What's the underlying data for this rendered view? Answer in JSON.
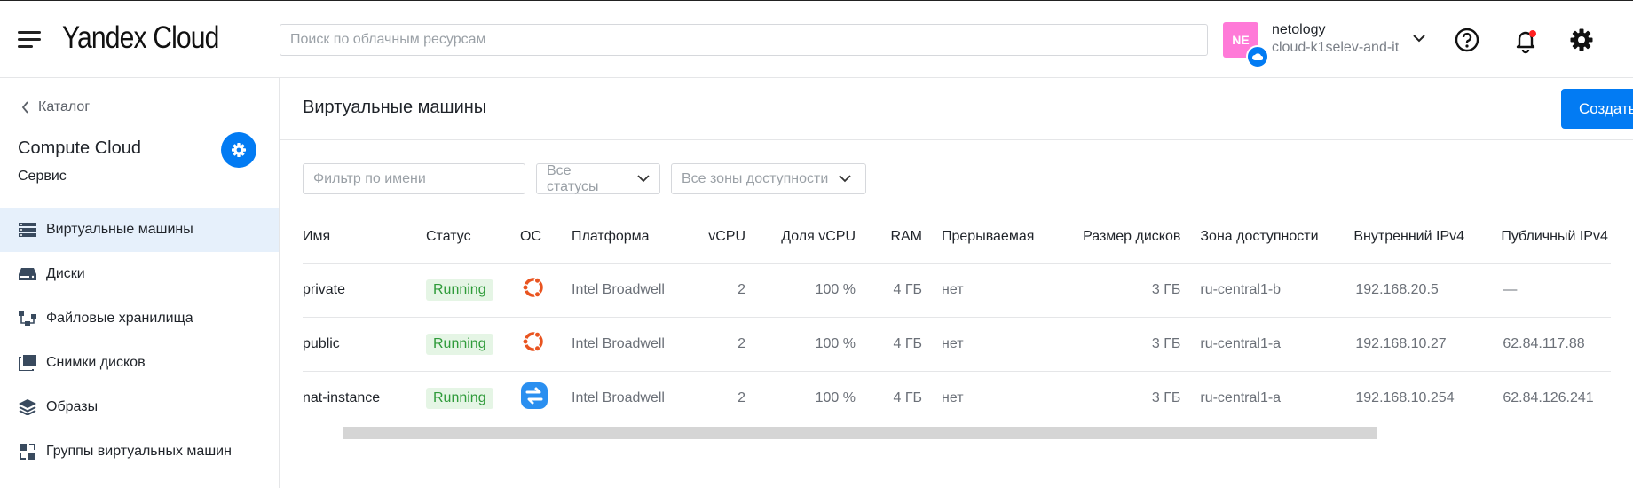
{
  "header": {
    "logo": "Yandex Cloud",
    "search_placeholder": "Поиск по облачным ресурсам",
    "avatar_initials": "NE",
    "account_name": "netology",
    "cloud_name": "cloud-k1selev-and-it"
  },
  "sidebar": {
    "back_label": "Каталог",
    "service_title": "Compute Cloud",
    "service_subtitle": "Сервис",
    "items": [
      {
        "label": "Виртуальные машины",
        "icon": "vm-icon",
        "active": true
      },
      {
        "label": "Диски",
        "icon": "disk-icon",
        "active": false
      },
      {
        "label": "Файловые хранилища",
        "icon": "filestore-icon",
        "active": false
      },
      {
        "label": "Снимки дисков",
        "icon": "snapshot-icon",
        "active": false
      },
      {
        "label": "Образы",
        "icon": "images-icon",
        "active": false
      },
      {
        "label": "Группы виртуальных машин",
        "icon": "instance-group-icon",
        "active": false
      }
    ]
  },
  "main": {
    "title": "Виртуальные машины",
    "create_label": "Создать",
    "filter_placeholder": "Фильтр по имени",
    "status_select": "Все статусы",
    "zone_select": "Все зоны доступности",
    "columns": {
      "name": "Имя",
      "status": "Статус",
      "os": "ОС",
      "platform": "Платформа",
      "vcpu": "vCPU",
      "vcpu_share": "Доля vCPU",
      "ram": "RAM",
      "preemptible": "Прерываемая",
      "disk_size": "Размер дисков",
      "zone": "Зона доступности",
      "internal_ip": "Внутренний IPv4",
      "public_ip": "Публичный IPv4"
    },
    "rows": [
      {
        "name": "private",
        "status": "Running",
        "os_icon": "ubuntu-icon",
        "platform": "Intel Broadwell",
        "vcpu": "2",
        "vcpu_share": "100 %",
        "ram": "4 ГБ",
        "preemptible": "нет",
        "disk_size": "3 ГБ",
        "zone": "ru-central1-b",
        "internal_ip": "192.168.20.5",
        "public_ip": "—"
      },
      {
        "name": "public",
        "status": "Running",
        "os_icon": "ubuntu-icon",
        "platform": "Intel Broadwell",
        "vcpu": "2",
        "vcpu_share": "100 %",
        "ram": "4 ГБ",
        "preemptible": "нет",
        "disk_size": "3 ГБ",
        "zone": "ru-central1-a",
        "internal_ip": "192.168.10.27",
        "public_ip": "62.84.117.88"
      },
      {
        "name": "nat-instance",
        "status": "Running",
        "os_icon": "nat-instance-icon",
        "platform": "Intel Broadwell",
        "vcpu": "2",
        "vcpu_share": "100 %",
        "ram": "4 ГБ",
        "preemptible": "нет",
        "disk_size": "3 ГБ",
        "zone": "ru-central1-a",
        "internal_ip": "192.168.10.254",
        "public_ip": "62.84.126.241"
      }
    ]
  },
  "colors": {
    "accent": "#027bf3",
    "status_bg": "#e5f5e5",
    "status_text": "#2f9b3a",
    "ubuntu": "#e95420",
    "avatar": "#ff7ad8"
  }
}
